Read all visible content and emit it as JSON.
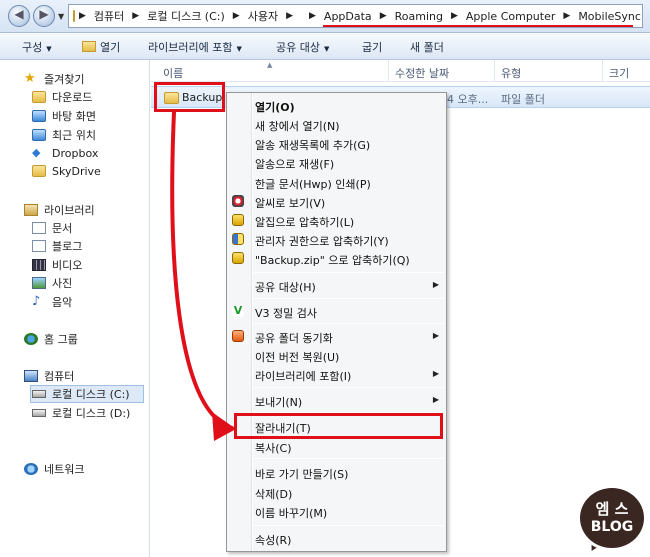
{
  "address": {
    "crumbs": [
      "컴퓨터",
      "로컬 디스크 (C:)",
      "사용자",
      "",
      "AppData",
      "Roaming",
      "Apple Computer",
      "MobileSync"
    ]
  },
  "toolbar": {
    "organize": "구성",
    "open": "열기",
    "include_library": "라이브러리에 포함",
    "share_with": "공유 대상",
    "burn": "굽기",
    "new_folder": "새 폴더"
  },
  "sidebar": {
    "favorites": "즐겨찾기",
    "downloads": "다운로드",
    "desktop": "바탕 화면",
    "recent": "최근 위치",
    "dropbox": "Dropbox",
    "skydrive": "SkyDrive",
    "libraries": "라이브러리",
    "documents": "문서",
    "blog": "블로그",
    "video": "비디오",
    "pictures": "사진",
    "music": "음악",
    "homegroup": "홈 그룹",
    "computer": "컴퓨터",
    "local_c": "로컬 디스크 (C:)",
    "local_d": "로컬 디스크 (D:)",
    "network": "네트워크"
  },
  "columns": {
    "name": "이름",
    "date_modified": "수정한 날짜",
    "type": "유형",
    "size": "크기"
  },
  "file": {
    "name": "Backup",
    "date_fragment": "4 오후...",
    "type": "파일 폴더"
  },
  "context_menu": {
    "open": "열기(O)",
    "open_new_window": "새 창에서 열기(N)",
    "add_alsong_playlist": "알송 재생목록에 추가(G)",
    "play_alsong": "알송으로 재생(F)",
    "print_hwp": "한글 문서(Hwp) 인쇄(P)",
    "view_alsee": "알씨로 보기(V)",
    "compress_alzip": "알집으로 압축하기(L)",
    "compress_admin": "관리자 권한으로 압축하기(Y)",
    "compress_to_zip": "\"Backup.zip\" 으로 압축하기(Q)",
    "share_with": "공유 대상(H)",
    "v3_scan": "V3 정밀 검사",
    "sync_shared_folder": "공유 폴더 동기화",
    "restore_previous": "이전 버전 복원(U)",
    "include_library": "라이브러리에 포함(I)",
    "send_to": "보내기(N)",
    "cut": "잘라내기(T)",
    "copy": "복사(C)",
    "create_shortcut": "바로 가기 만들기(S)",
    "delete": "삭제(D)",
    "rename": "이름 바꾸기(M)",
    "properties": "속성(R)"
  },
  "watermark": {
    "line1": "엠 스",
    "line2": "BLOG"
  },
  "colors": {
    "highlight_red": "#e0101a",
    "selection_blue": "#d7e7f8"
  }
}
